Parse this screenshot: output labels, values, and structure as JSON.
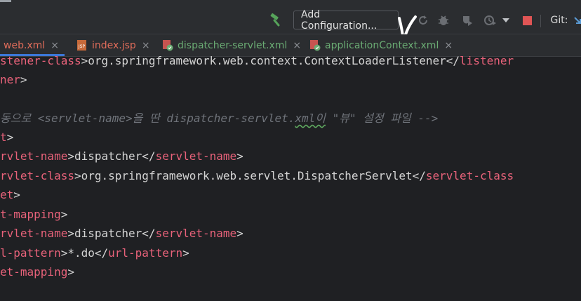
{
  "toolbar": {
    "run_configuration": "Add Configuration...",
    "git_label": "Git:"
  },
  "tabs": [
    {
      "label": "web.xml",
      "type": "xml",
      "active": true
    },
    {
      "label": "index.jsp",
      "type": "jsp",
      "active": false
    },
    {
      "label": "dispatcher-servlet.xml",
      "type": "spring-xml",
      "active": false
    },
    {
      "label": "applicationContext.xml",
      "type": "spring-xml",
      "active": false
    }
  ],
  "tab_close": "×",
  "icons": {
    "hammer": "hammer-icon",
    "rerun": "rerun-icon",
    "debug": "bug-icon",
    "coverage": "coverage-icon",
    "profile": "profile-icon",
    "stop": "stop-icon",
    "dropdown": "chevron-down-icon",
    "file_xml": "xml-file-icon",
    "file_jsp": "jsp-file-icon",
    "file_spring": "spring-xml-file-icon"
  },
  "colors": {
    "tag": "#e8627a",
    "text": "#d4d4d4",
    "comment": "#6f737a",
    "stop": "#e05555",
    "hammer": "#56a35a"
  },
  "editor": {
    "lines": [
      {
        "tag1": "stener-class",
        "text": "org.springframework.web.context.ContextLoaderListener",
        "tag2": "listener"
      },
      {
        "tag1": "ner"
      },
      {},
      {
        "comment_pre": "동으로 <servlet-name>을 딴 dispatcher-servlet.",
        "comment_squiggle": "xml이",
        "comment_post": " \"뷰\" 설정 파일 -->"
      },
      {
        "tag1": "t"
      },
      {
        "tag1": "rvlet-name",
        "text": "dispatcher",
        "tag2": "servlet-name"
      },
      {
        "tag1": "rvlet-class",
        "text": "org.springframework.web.servlet.DispatcherServlet",
        "tag2": "servlet-class"
      },
      {
        "tag1": "et"
      },
      {
        "tag1": "t-mapping"
      },
      {
        "tag1": "rvlet-name",
        "text": "dispatcher",
        "tag2": "servlet-name"
      },
      {
        "tag1": "l-pattern",
        "text": "*.do",
        "tag2": "url-pattern"
      },
      {
        "tag1": "et-mapping"
      }
    ]
  }
}
